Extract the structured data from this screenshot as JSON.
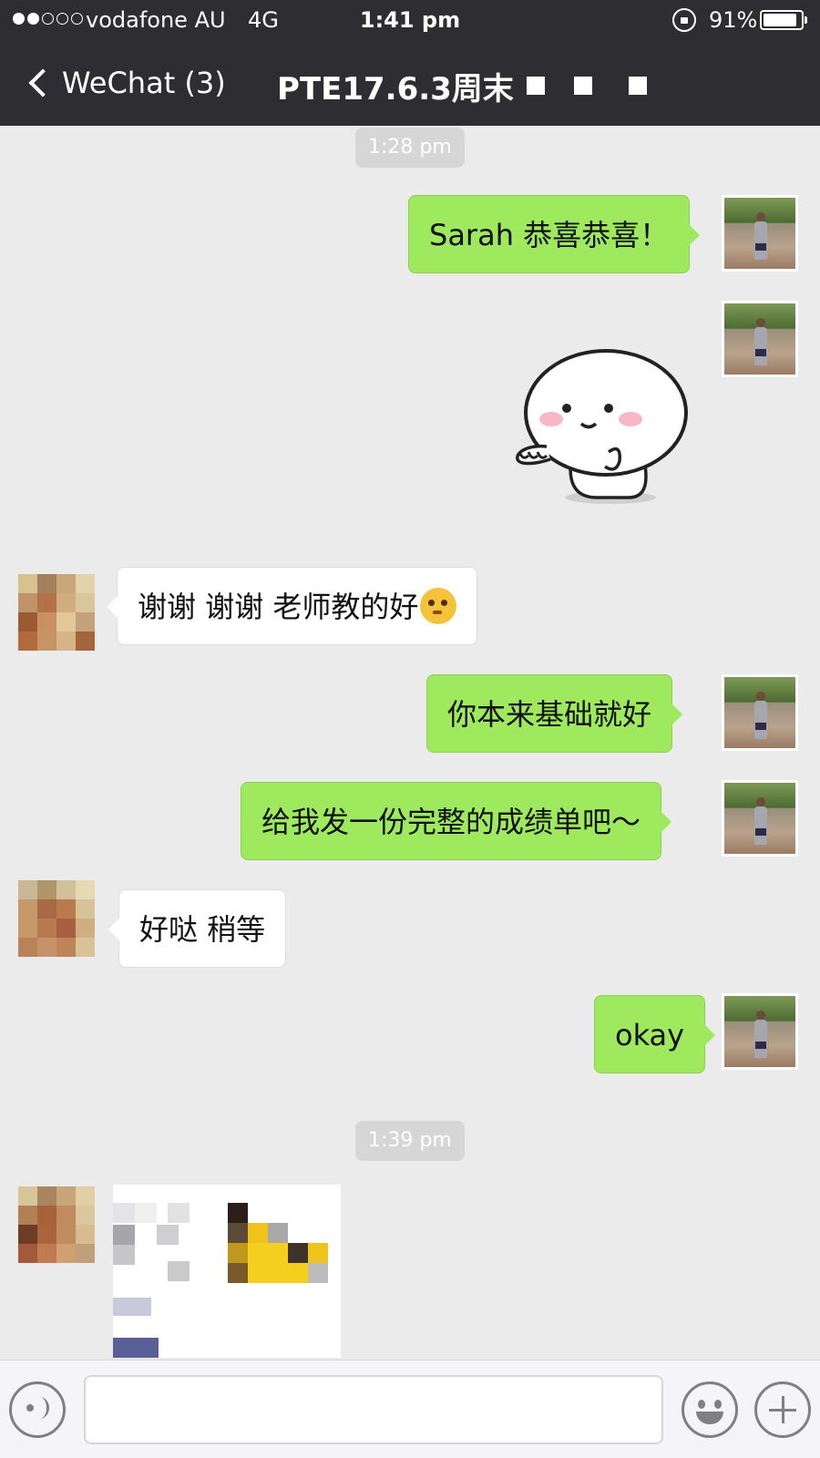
{
  "status_bar": {
    "carrier": "vodafone AU",
    "network": "4G",
    "time": "1:41 pm",
    "battery_percent": "91%",
    "battery_level": 0.91,
    "signal_bars_filled": 2,
    "signal_bars_total": 5
  },
  "nav": {
    "back_label": "WeChat (3)",
    "title": "PTE17.6.3周末"
  },
  "messages": {
    "timestamp_1": "1:28 pm",
    "m1": "Sarah 恭喜恭喜！",
    "m3": "谢谢 谢谢 老师教的好",
    "m4": "你本来基础就好",
    "m5": "给我发一份完整的成绩单吧～",
    "m6": "好哒 稍等",
    "m7": "okay",
    "timestamp_2": "1:39 pm"
  },
  "input": {
    "placeholder": ""
  },
  "colors": {
    "sent_bubble": "#9ee95d",
    "received_bubble": "#ffffff",
    "nav_background": "#2e2e32",
    "chat_background": "#ebebeb"
  },
  "icons": [
    "chevron-left-icon",
    "lock-rotation-icon",
    "battery-icon",
    "voice-icon",
    "emoji-icon",
    "plus-icon",
    "thinking-emoji-icon"
  ]
}
